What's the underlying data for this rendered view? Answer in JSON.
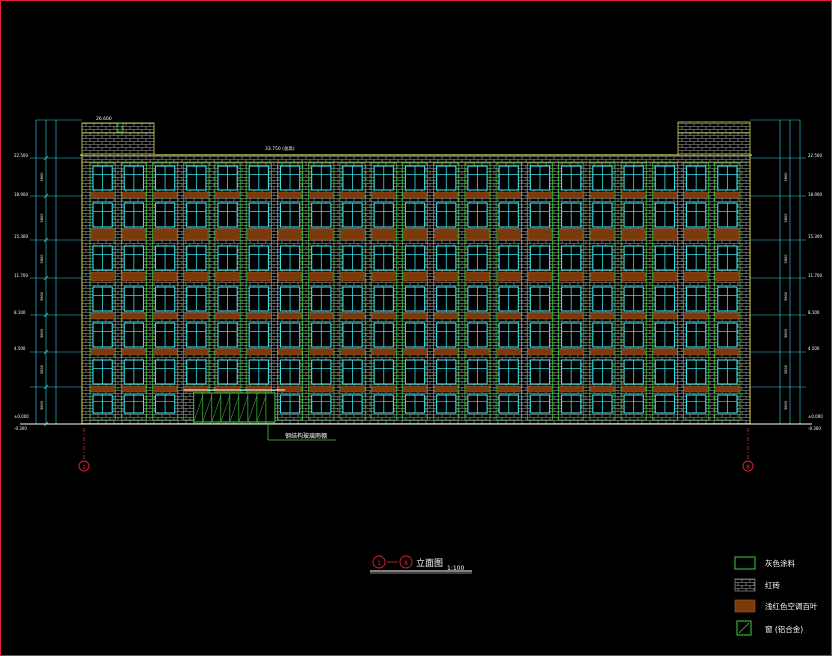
{
  "drawing": {
    "title": "立面图",
    "scale": "1:100",
    "axis_start": "1",
    "axis_end": "8",
    "canopy_callout": "钢结构玻璃雨棚",
    "roof_dimension": "33.750 (总高)",
    "penthouse_dimension": "26.600",
    "elevations_left": [
      "±0.000",
      "4.500",
      "8.100",
      "11.700",
      "15.300",
      "18.900",
      "22.500"
    ],
    "elevations_right": [
      "±0.000",
      "4.500",
      "8.100",
      "11.700",
      "15.300",
      "18.900",
      "22.500"
    ],
    "ground_level_left": "-0.300",
    "ground_level_right": "-0.300"
  },
  "legend": [
    {
      "label": "灰色涂料",
      "kind": "outline-green"
    },
    {
      "label": "红砖",
      "kind": "brick"
    },
    {
      "label": "浅红色空调百叶",
      "kind": "louver"
    },
    {
      "label": "窗 (铝合金)",
      "kind": "window"
    }
  ],
  "colors": {
    "frame": "#e0233a",
    "brick_line": "#b0b0b0",
    "pier": "#3bd23b",
    "window": "#38e0e6",
    "louver": "#7a3a0c",
    "dim": "#33d6e8",
    "axis": "#e0233a",
    "roof": "#d8d84a"
  }
}
